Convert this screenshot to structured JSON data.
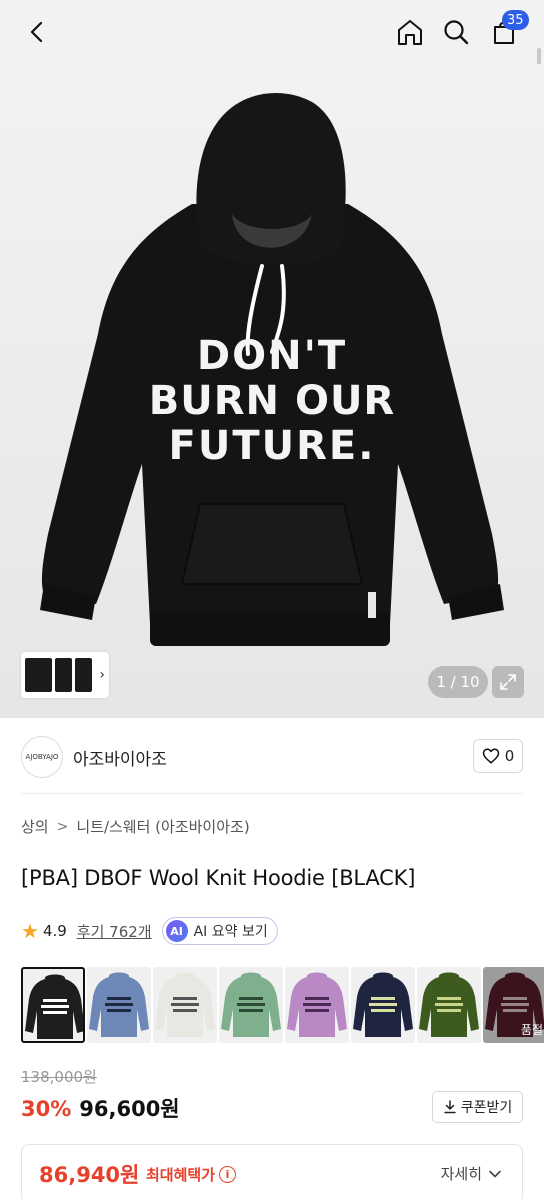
{
  "header": {
    "back_icon": "chevron-left-icon",
    "home_icon": "home-icon",
    "search_icon": "search-icon",
    "cart_icon": "shopping-bag-icon",
    "cart_count": "35"
  },
  "gallery": {
    "counter": "1 / 10",
    "expand_icon": "expand-icon",
    "thumbs_icon": "chevron-right-icon",
    "artwork_text": [
      "DON'T",
      "BURN OUR",
      "FUTURE."
    ]
  },
  "brand": {
    "logo_text": "AJOBYAJO",
    "name": "아조바이아조",
    "like_icon": "heart-icon",
    "like_count": "0"
  },
  "breadcrumb": {
    "level1": "상의",
    "level2": "니트/스웨터 (아조바이아조)",
    "separator_icon": "chevron-right-icon"
  },
  "product": {
    "title": "[PBA] DBOF Wool Knit Hoodie [BLACK]"
  },
  "rating": {
    "star_icon": "star-icon",
    "score": "4.9",
    "reviews": "후기 762개",
    "ai_badge": "AI",
    "ai_label": "AI 요약 보기"
  },
  "swatches": [
    {
      "color": "#1e1e1e",
      "text_color": "#ffffff",
      "selected": true,
      "soldout": false
    },
    {
      "color": "#6d88b6",
      "text_color": "#1e2a44",
      "selected": false,
      "soldout": false
    },
    {
      "color": "#e9e7e1",
      "text_color": "#555555",
      "selected": false,
      "soldout": false
    },
    {
      "color": "#7fb08d",
      "text_color": "#2a4a35",
      "selected": false,
      "soldout": false
    },
    {
      "color": "#b889c4",
      "text_color": "#4b2a55",
      "selected": false,
      "soldout": false
    },
    {
      "color": "#1f2540",
      "text_color": "#d8e0a0",
      "selected": false,
      "soldout": false
    },
    {
      "color": "#3d5a1f",
      "text_color": "#c9d68a",
      "selected": false,
      "soldout": false
    },
    {
      "color": "#5a1e2c",
      "text_color": "#e6c9cf",
      "selected": false,
      "soldout": true,
      "soldout_label": "품절"
    }
  ],
  "pricing": {
    "original": "138,000원",
    "discount": "30%",
    "sale": "96,600원",
    "coupon_icon": "download-icon",
    "coupon_label": "쿠폰받기"
  },
  "benefit": {
    "price": "86,940원",
    "label": "최대혜택가",
    "info_icon": "info-icon",
    "detail_label": "자세히",
    "detail_icon": "chevron-down-icon"
  },
  "colors": {
    "accent_red": "#e8412b",
    "badge_blue": "#2c5ee8",
    "star_yellow": "#f5a623"
  }
}
